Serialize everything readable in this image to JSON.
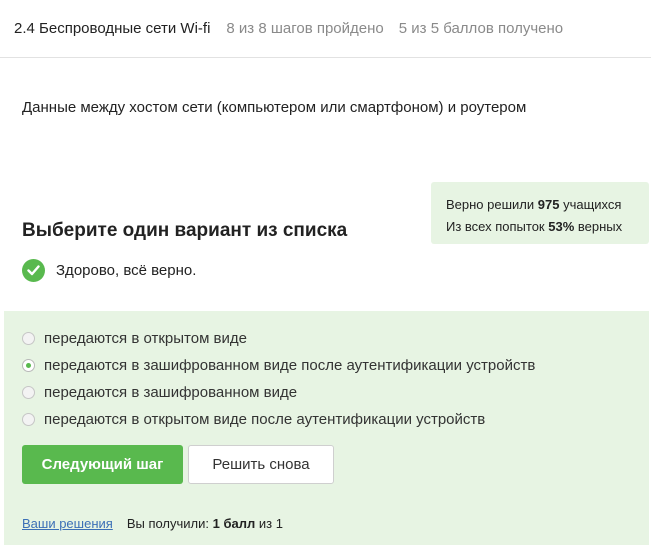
{
  "header": {
    "title": "2.4 Беспроводные сети Wi-fi",
    "steps": "8 из 8 шагов пройдено",
    "points": "5 из 5 баллов  получено"
  },
  "question": {
    "text": "Данные между хостом сети (компьютером или смартфоном) и роутером"
  },
  "stats": {
    "line1_prefix": "Верно решили ",
    "solved_count": "975",
    "line1_suffix": " учащихся",
    "line2_prefix": "Из всех попыток ",
    "percent": "53%",
    "line2_suffix": " верных"
  },
  "prompt": "Выберите один вариант из списка",
  "feedback": {
    "text": "Здорово, всё верно.",
    "icon": "check-circle-icon",
    "color": "#59b94e"
  },
  "options": [
    {
      "label": "передаются в открытом виде",
      "checked": false
    },
    {
      "label": "передаются в зашифрованном виде после аутентификации устройств",
      "checked": true
    },
    {
      "label": "передаются в зашифрованном виде",
      "checked": false
    },
    {
      "label": "передаются в открытом виде после аутентификации устройств",
      "checked": false
    }
  ],
  "buttons": {
    "next": "Следующий шаг",
    "retry": "Решить снова"
  },
  "footer": {
    "solutions_link": "Ваши решения",
    "score_prefix": "Вы получили: ",
    "score_value": "1 балл",
    "score_suffix": " из 1"
  },
  "colors": {
    "accent": "#59b94e",
    "panel_bg": "#e7f4e3",
    "link": "#3b6fb6"
  }
}
